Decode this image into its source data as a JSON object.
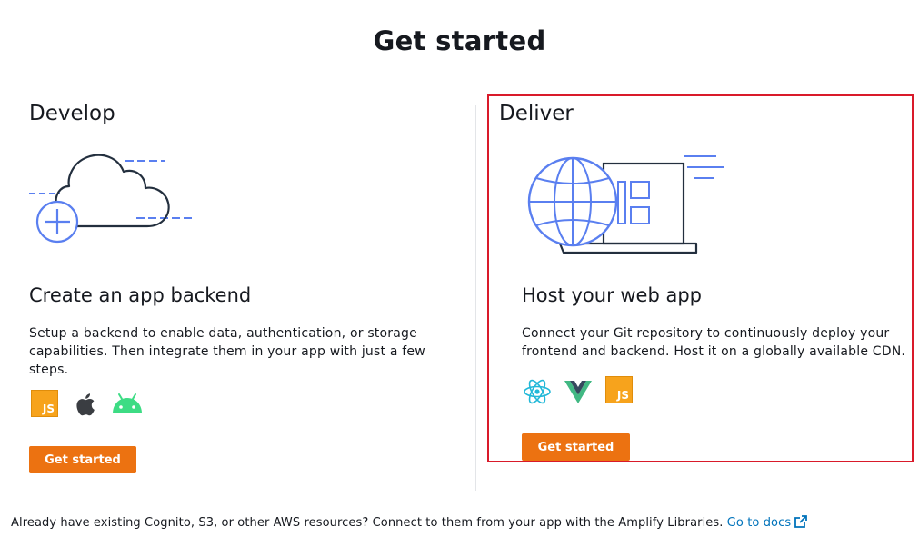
{
  "page": {
    "title": "Get started"
  },
  "develop": {
    "heading": "Develop",
    "card_title": "Create an app backend",
    "description": "Setup a backend to enable data, authentication, or storage capabilities. Then integrate them in your app with just a few steps.",
    "icons": [
      "javascript-icon",
      "apple-icon",
      "android-icon"
    ],
    "js_label": "JS",
    "button_label": "Get started"
  },
  "deliver": {
    "heading": "Deliver",
    "card_title": "Host your web app",
    "description": "Connect your Git repository to continuously deploy your frontend and backend. Host it on a globally available CDN.",
    "icons": [
      "react-icon",
      "vue-icon",
      "javascript-icon"
    ],
    "js_label": "JS",
    "button_label": "Get started"
  },
  "footer": {
    "text": "Already have existing Cognito, S3, or other AWS resources? Connect to them from your app with the Amplify Libraries.",
    "link_label": "Go to docs"
  },
  "colors": {
    "primary_button": "#ec7211",
    "link": "#0073bb",
    "illustration_accent": "#5a7ff0",
    "illustration_line": "#232f3e",
    "highlight": "#d91a2a"
  }
}
